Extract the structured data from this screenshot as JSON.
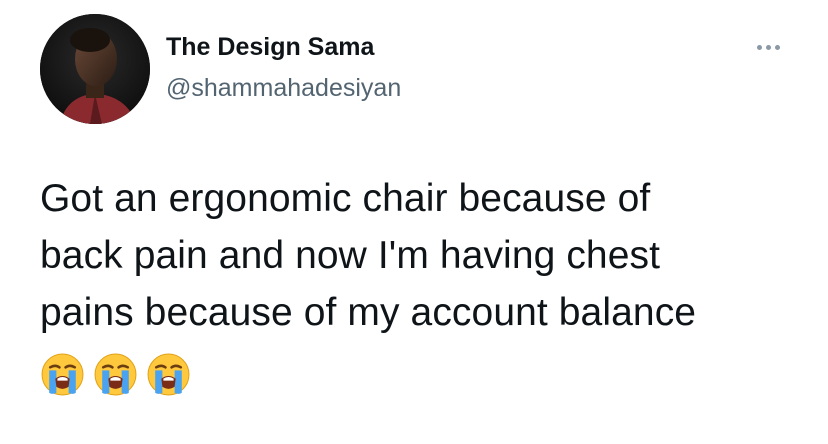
{
  "tweet": {
    "author_name": "The Design Sama",
    "author_handle": "@shammahadesiyan",
    "text_lines": [
      "Got an ergonomic chair because of",
      "back pain and now I'm having chest",
      "pains because of my account balance"
    ],
    "emojis": [
      "loudly-crying-face",
      "loudly-crying-face",
      "loudly-crying-face"
    ],
    "more_icon": "more-options-icon"
  },
  "colors": {
    "text": "#0f1419",
    "secondary": "#536471",
    "background": "#ffffff"
  }
}
